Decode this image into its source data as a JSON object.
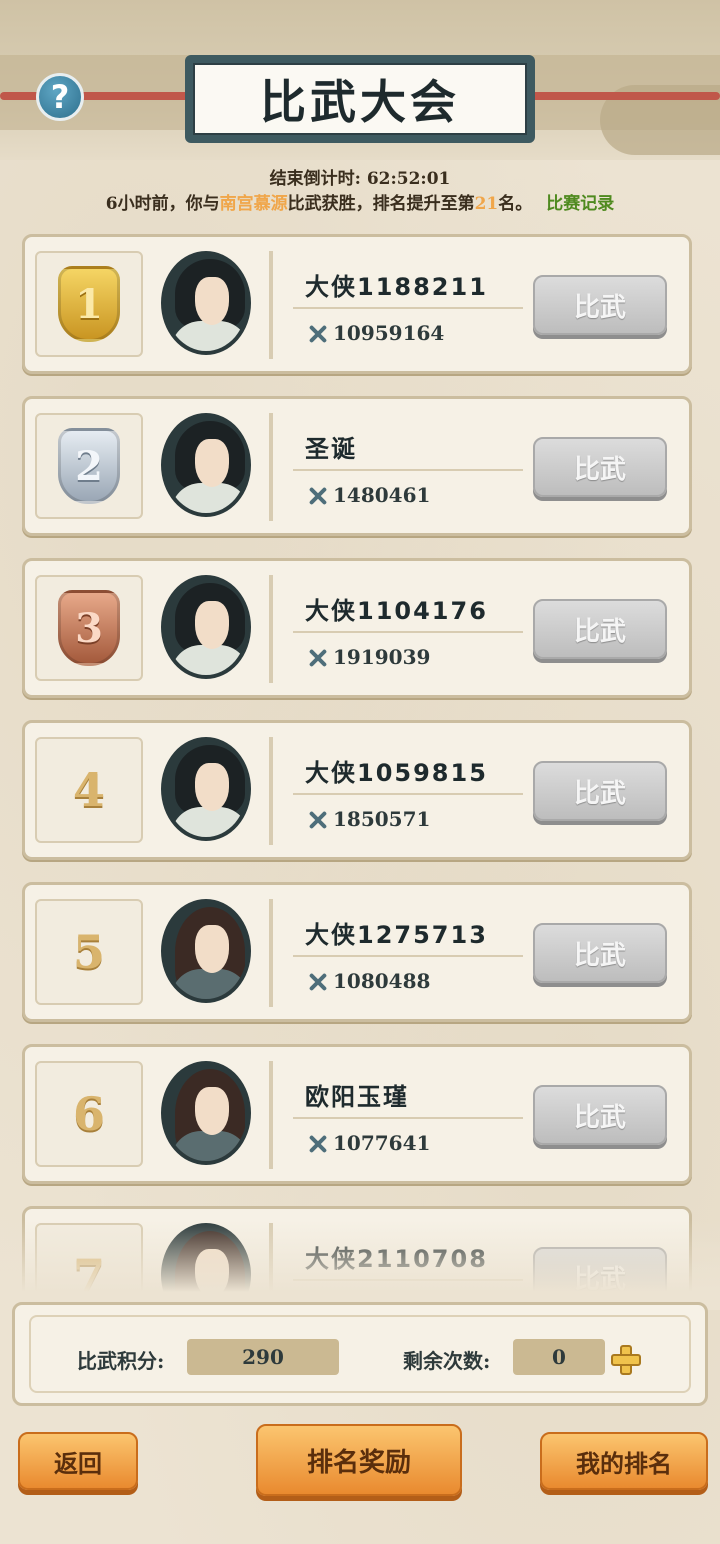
{
  "header": {
    "title": "比武大会",
    "help_icon": "question-icon",
    "help_glyph": "?"
  },
  "status": {
    "countdown_label": "结束倒计时:",
    "countdown_value": "62:52:01",
    "notice_prefix": "6小时前，你与",
    "opponent": "南宫慕源",
    "notice_middle": "比武获胜，排名提升至第",
    "rank": "21",
    "notice_suffix": "名。",
    "record_link": "比赛记录"
  },
  "players": [
    {
      "rank": "1",
      "name": "大侠1188211",
      "power": "10959164",
      "medal": "gold",
      "avatar": "black-hair"
    },
    {
      "rank": "2",
      "name": "圣诞",
      "power": "1480461",
      "medal": "silver",
      "avatar": "black-hair"
    },
    {
      "rank": "3",
      "name": "大侠1104176",
      "power": "1919039",
      "medal": "bronze",
      "avatar": "black-hair"
    },
    {
      "rank": "4",
      "name": "大侠1059815",
      "power": "1850571",
      "medal": "none",
      "avatar": "black-hair"
    },
    {
      "rank": "5",
      "name": "大侠1275713",
      "power": "1080488",
      "medal": "none",
      "avatar": "brown-hair"
    },
    {
      "rank": "6",
      "name": "欧阳玉瑾",
      "power": "1077641",
      "medal": "none",
      "avatar": "brown-hair"
    },
    {
      "rank": "7",
      "name": "大侠2110708",
      "power": "",
      "medal": "none",
      "avatar": "brown-hair"
    }
  ],
  "fight_button_label": "比武",
  "score": {
    "points_label": "比武积分:",
    "points_value": "290",
    "remaining_label": "剩余次数:",
    "remaining_value": "0"
  },
  "footer": {
    "back_label": "返回",
    "rewards_label": "排名奖励",
    "my_rank_label": "我的排名"
  },
  "colors": {
    "highlight": "#f0a64a",
    "link": "#4f8a1f",
    "button_orange": "#e98a2f",
    "button_gray": "#bdbdbd"
  }
}
